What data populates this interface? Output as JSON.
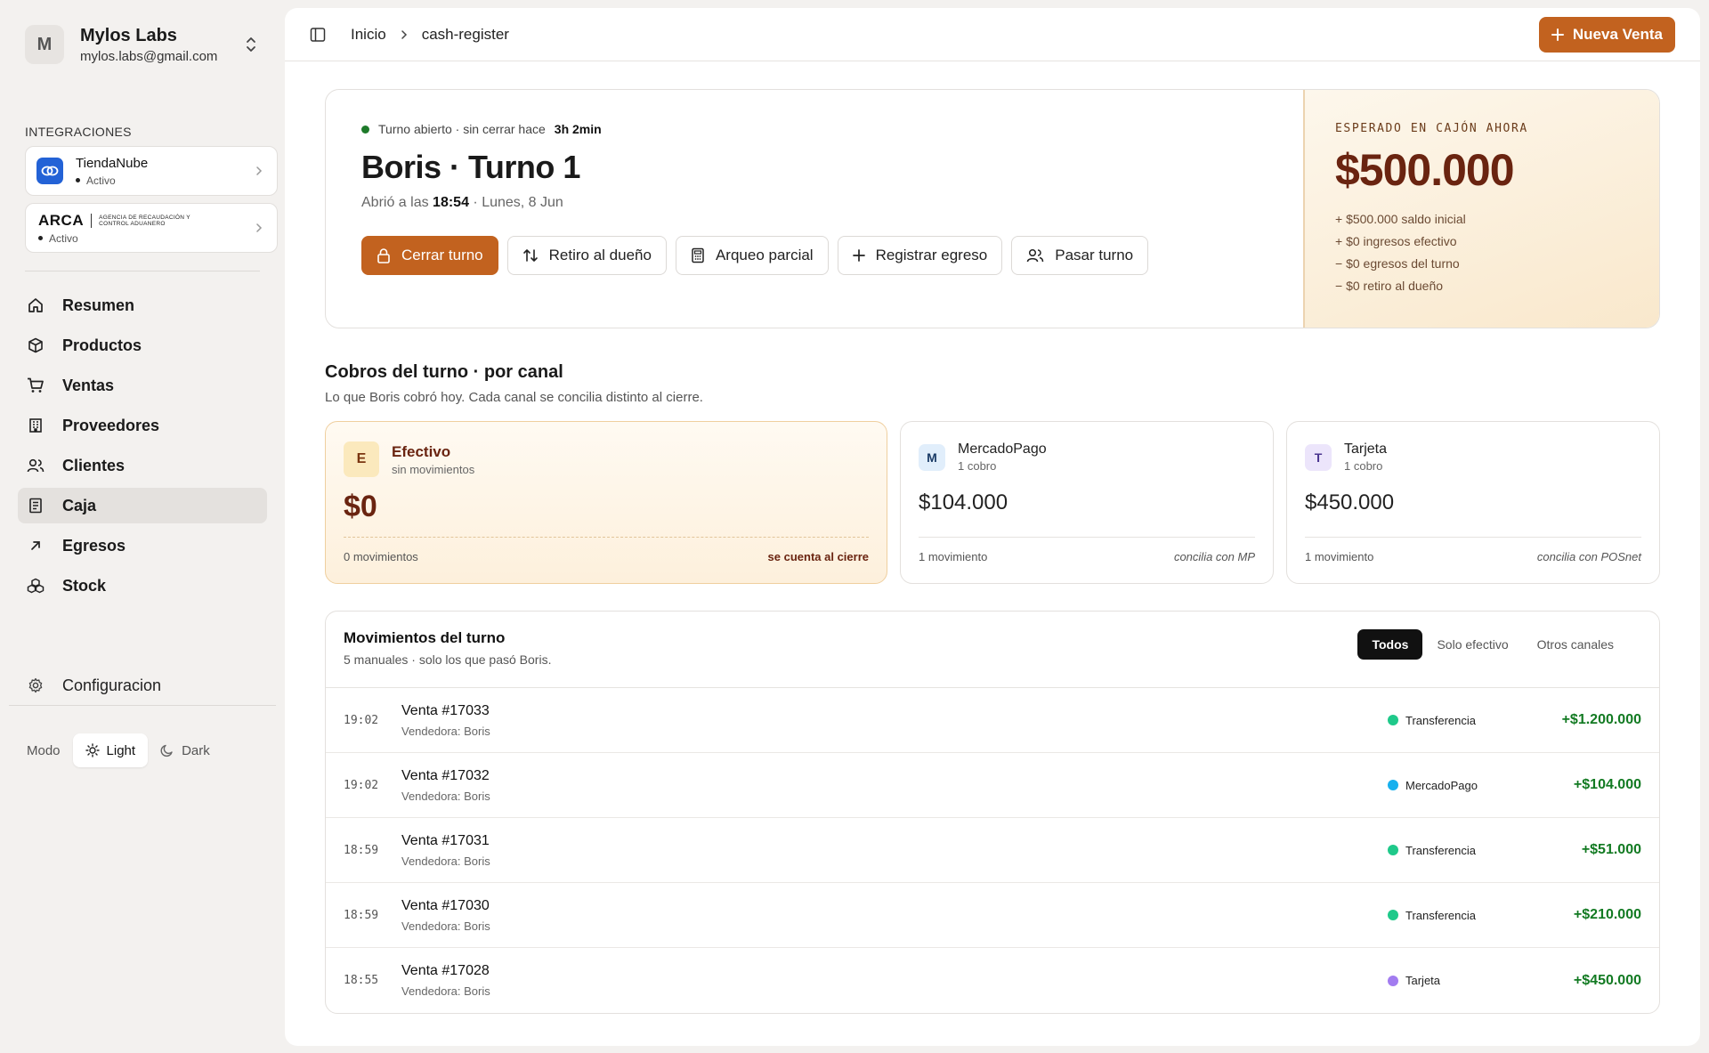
{
  "account": {
    "initial": "M",
    "name": "Mylos Labs",
    "email": "mylos.labs@gmail.com"
  },
  "integrations": {
    "label": "INTEGRACIONES",
    "items": [
      {
        "name": "TiendaNube",
        "status": "Activo"
      },
      {
        "name": "ARCA",
        "subtitle": "AGENCIA DE RECAUDACIÓN Y CONTROL ADUANERO",
        "status": "Activo"
      }
    ]
  },
  "nav": [
    {
      "label": "Resumen",
      "icon": "home-icon"
    },
    {
      "label": "Productos",
      "icon": "box-icon"
    },
    {
      "label": "Ventas",
      "icon": "cart-icon"
    },
    {
      "label": "Proveedores",
      "icon": "building-icon"
    },
    {
      "label": "Clientes",
      "icon": "users-icon"
    },
    {
      "label": "Caja",
      "icon": "receipt-icon",
      "active": true
    },
    {
      "label": "Egresos",
      "icon": "arrow-up-right-icon"
    },
    {
      "label": "Stock",
      "icon": "boxes-icon"
    }
  ],
  "config_label": "Configuracion",
  "mode": {
    "label": "Modo",
    "light": "Light",
    "dark": "Dark",
    "selected": "Light"
  },
  "topbar": {
    "crumb_home": "Inicio",
    "crumb_current": "cash-register",
    "new_sale": "Nueva Venta"
  },
  "shift": {
    "status_text": "Turno abierto · sin cerrar hace",
    "status_duration": "3h 2min",
    "title": "Boris · Turno 1",
    "opened_prefix": "Abrió a las",
    "opened_time": "18:54",
    "opened_suffix": "· Lunes, 8 Jun",
    "actions": {
      "close": "Cerrar turno",
      "withdraw": "Retiro al dueño",
      "count": "Arqueo parcial",
      "expense": "Registrar egreso",
      "handover": "Pasar turno"
    }
  },
  "expected": {
    "label": "ESPERADO EN CAJÓN AHORA",
    "value": "$500.000",
    "lines": [
      "+ $500.000 saldo inicial",
      "+ $0 ingresos efectivo",
      "− $0 egresos del turno",
      "− $0 retiro al dueño"
    ]
  },
  "channels_section": {
    "title": "Cobros del turno · por canal",
    "subtitle": "Lo que Boris cobró hoy. Cada canal se concilia distinto al cierre."
  },
  "channels": {
    "cash": {
      "badge": "E",
      "name": "Efectivo",
      "sub": "sin movimientos",
      "amount": "$0",
      "footer_left": "0 movimientos",
      "footer_right": "se cuenta al cierre"
    },
    "mp": {
      "badge": "M",
      "name": "MercadoPago",
      "sub": "1 cobro",
      "amount": "$104.000",
      "footer_left": "1 movimiento",
      "footer_right": "concilia con MP"
    },
    "card": {
      "badge": "T",
      "name": "Tarjeta",
      "sub": "1 cobro",
      "amount": "$450.000",
      "footer_left": "1 movimiento",
      "footer_right": "concilia con POSnet"
    }
  },
  "moves": {
    "title": "Movimientos del turno",
    "subtitle": "5 manuales · solo los que pasó Boris.",
    "tabs": [
      "Todos",
      "Solo efectivo",
      "Otros canales"
    ],
    "rows": [
      {
        "time": "19:02",
        "title": "Venta #17033",
        "sub": "Vendedora: Boris",
        "channel": "Transferencia",
        "color": "#1fc98a",
        "amount": "+$1.200.000"
      },
      {
        "time": "19:02",
        "title": "Venta #17032",
        "sub": "Vendedora: Boris",
        "channel": "MercadoPago",
        "color": "#17b0ee",
        "amount": "+$104.000"
      },
      {
        "time": "18:59",
        "title": "Venta #17031",
        "sub": "Vendedora: Boris",
        "channel": "Transferencia",
        "color": "#1fc98a",
        "amount": "+$51.000"
      },
      {
        "time": "18:59",
        "title": "Venta #17030",
        "sub": "Vendedora: Boris",
        "channel": "Transferencia",
        "color": "#1fc98a",
        "amount": "+$210.000"
      },
      {
        "time": "18:55",
        "title": "Venta #17028",
        "sub": "Vendedora: Boris",
        "channel": "Tarjeta",
        "color": "#a27cf0",
        "amount": "+$450.000"
      }
    ]
  }
}
